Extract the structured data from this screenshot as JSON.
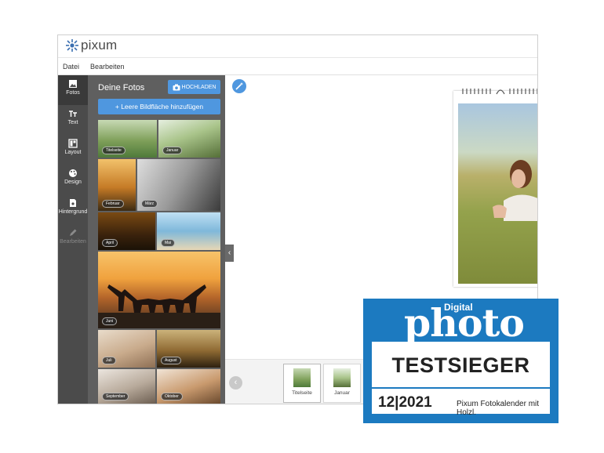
{
  "app": {
    "logo_text": "pixum",
    "menu": [
      "Datei",
      "Bearbeiten"
    ]
  },
  "rail": [
    {
      "label": "Fotos",
      "icon": "image-icon",
      "active": true
    },
    {
      "label": "Text",
      "icon": "text-icon"
    },
    {
      "label": "Layout",
      "icon": "layout-icon"
    },
    {
      "label": "Design",
      "icon": "palette-icon"
    },
    {
      "label": "Hintergrund",
      "icon": "background-icon"
    },
    {
      "label": "Bearbeiten",
      "icon": "pencil-icon",
      "disabled": true
    }
  ],
  "panel": {
    "title": "Deine Fotos",
    "upload_label": "HOCHLADEN",
    "add_label": "+ Leere Bildfläche hinzufügen",
    "thumbnails": [
      "Titelseite",
      "Januar",
      "Februar",
      "März",
      "April",
      "Mai",
      "Juni",
      "Juli",
      "August",
      "September",
      "Oktober"
    ]
  },
  "strip": {
    "pages": [
      "Titelseite",
      "Januar"
    ]
  },
  "award": {
    "subtitle": "Digital",
    "brand": "photo",
    "headline": "TESTSIEGER",
    "issue": "12|2021",
    "product": "Pixum Fotokalender mit Holzl."
  },
  "colors": {
    "accent": "#4f97df",
    "rail_bg": "#4b4b4b",
    "panel_bg": "#5f5f5f",
    "award_blue": "#1c7ac0"
  }
}
